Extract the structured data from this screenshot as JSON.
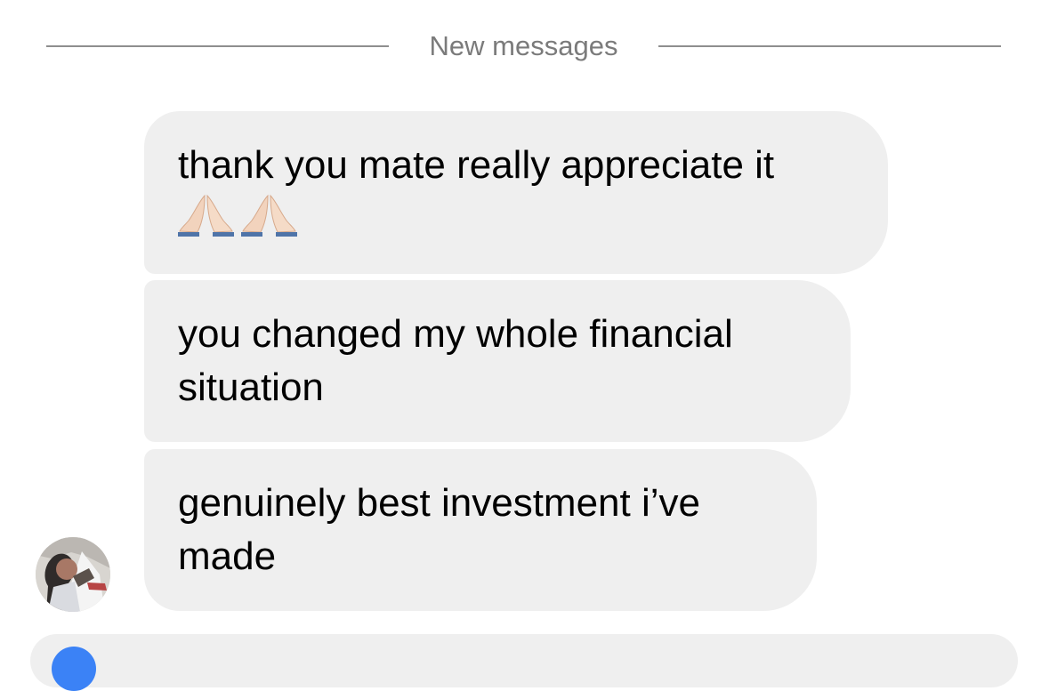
{
  "divider": {
    "label": "New messages"
  },
  "messages": [
    {
      "text": "thank you mate really appreciate it",
      "emoji": [
        "folded-hands-emoji",
        "folded-hands-emoji"
      ]
    },
    {
      "text": "you changed my whole financial\nsituation"
    },
    {
      "text": "genuinely best investment i’ve\nmade"
    }
  ],
  "colors": {
    "bubble": "#efefef",
    "divider_text": "#7b7b7b",
    "divider_line": "#8e8e8e",
    "composer_icon": "#3b82f6"
  },
  "icons": {
    "avatar": "profile-photo-avatar",
    "composer": "camera-icon"
  }
}
